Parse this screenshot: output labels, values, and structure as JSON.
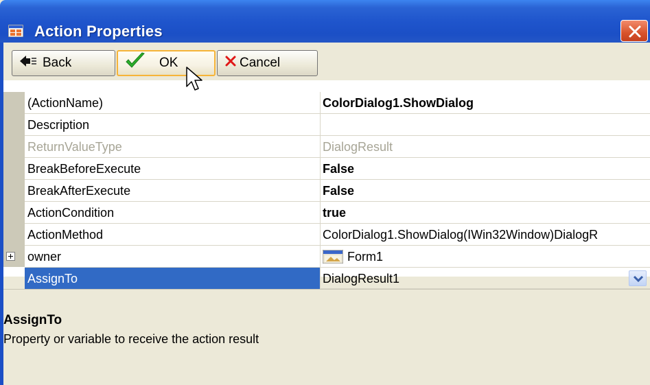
{
  "window": {
    "title": "Action Properties"
  },
  "toolbar": {
    "back_label": "Back",
    "ok_label": "OK",
    "cancel_label": "Cancel"
  },
  "properties": [
    {
      "name": "(ActionName)",
      "value": "ColorDialog1.ShowDialog"
    },
    {
      "name": "Description",
      "value": ""
    },
    {
      "name": "ReturnValueType",
      "value": "DialogResult"
    },
    {
      "name": "BreakBeforeExecute",
      "value": "False"
    },
    {
      "name": "BreakAfterExecute",
      "value": "False"
    },
    {
      "name": "ActionCondition",
      "value": "true"
    },
    {
      "name": "ActionMethod",
      "value": "ColorDialog1.ShowDialog(IWin32Window)DialogR"
    },
    {
      "name": "owner",
      "value": "Form1"
    },
    {
      "name": "AssignTo",
      "value": "DialogResult1"
    }
  ],
  "help": {
    "title": "AssignTo",
    "description": "Property or variable to receive the action result"
  },
  "colors": {
    "titlebar": "#1f55cc",
    "selection": "#316ac5",
    "window_bg": "#ece9d8"
  }
}
